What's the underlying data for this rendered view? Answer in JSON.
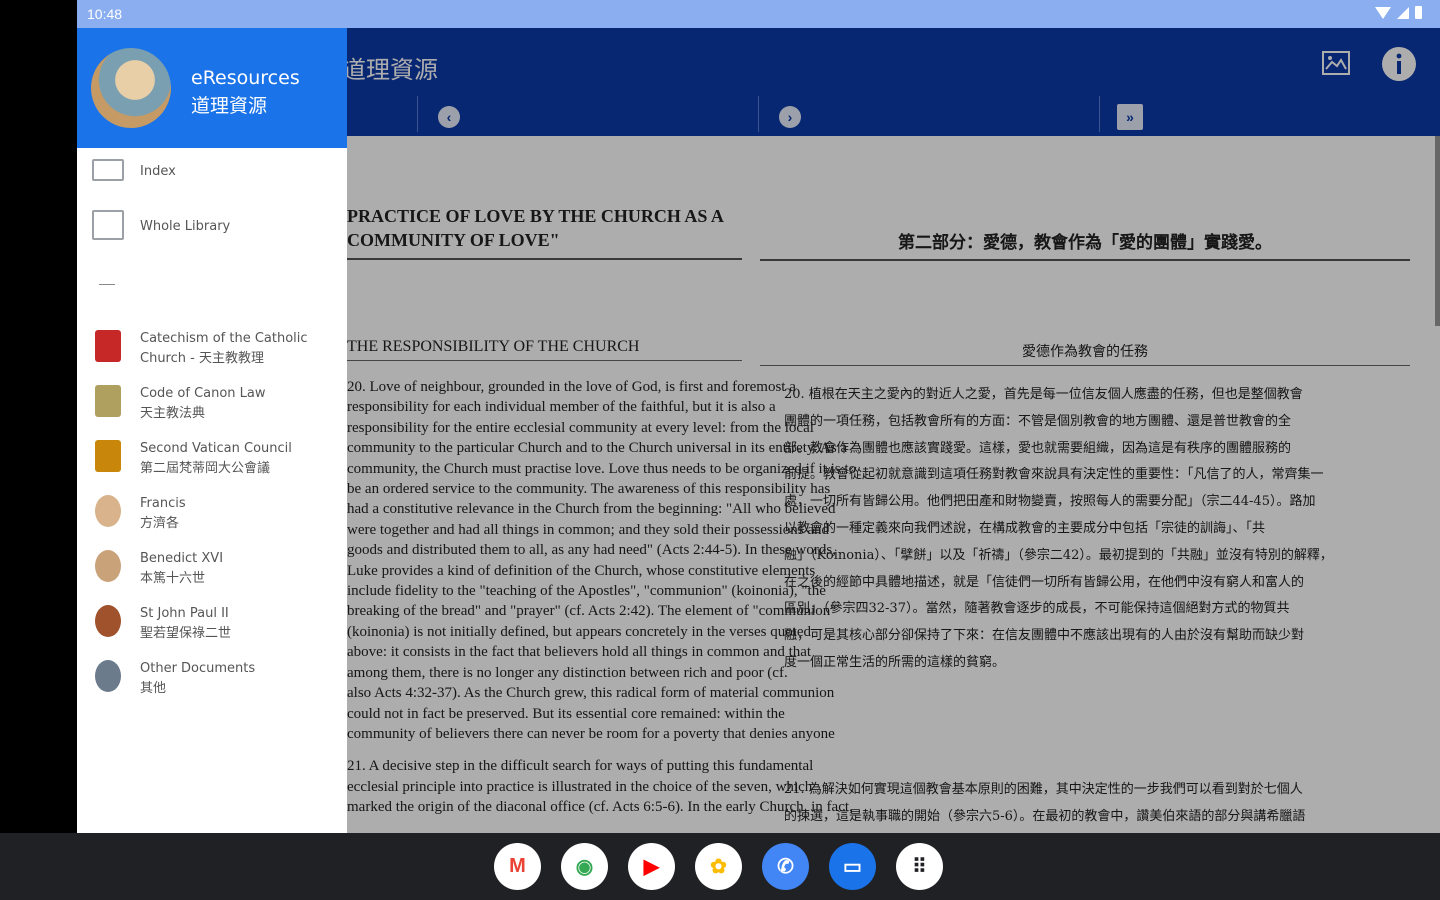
{
  "status": {
    "time": "10:48"
  },
  "app": {
    "title": "道理資源"
  },
  "drawer": {
    "title_line1": "eResources",
    "title_line2": "道理資源",
    "items": [
      {
        "line1": "Index",
        "line2": "",
        "icon": "list-icon"
      },
      {
        "line1": "Whole Library",
        "line2": "",
        "icon": "library-icon"
      },
      {
        "line1": "Catechism of the Catholic",
        "line2": "Church - 天主教教理",
        "icon": "catechism-icon"
      },
      {
        "line1": "Code of Canon Law",
        "line2": "天主教法典",
        "icon": "canon-law-icon"
      },
      {
        "line1": "Second Vatican Council",
        "line2": "第二屆梵蒂岡大公會議",
        "icon": "vatican-council-icon"
      },
      {
        "line1": "Francis",
        "line2": "方濟各",
        "icon": "pope-francis-icon"
      },
      {
        "line1": "Benedict XVI",
        "line2": "本篤十六世",
        "icon": "pope-benedict-icon"
      },
      {
        "line1": "St John Paul II",
        "line2": "聖若望保祿二世",
        "icon": "pope-john-paul-icon"
      },
      {
        "line1": "Other Documents",
        "line2": "其他",
        "icon": "other-documents-icon"
      }
    ]
  },
  "content": {
    "heading_en_1": "PRACTICE OF LOVE BY THE CHURCH AS A",
    "heading_en_2": "COMMUNITY OF LOVE\"",
    "heading_zh": "第二部分：愛德，教會作為「愛的團體」實踐愛。",
    "sub_en": "THE RESPONSIBILITY OF THE CHURCH",
    "sub_zh": "愛德作為教會的任務",
    "para20_en": [
      "20. Love of neighbour, grounded in the love of God, is first and foremost a",
      "responsibility for each individual member of the faithful, but it is also a",
      "responsibility for the entire ecclesial community at every level: from the local",
      "community to the particular Church and to the Church universal in its entirety. As a",
      "community, the Church must practise love. Love thus needs to be organized if it is to",
      "be an ordered service to the community. The awareness of this responsibility has",
      "had a constitutive relevance in the Church from the beginning: \"All who believed",
      "were together and had all things in common; and they sold their possessions and",
      "goods and distributed them to all, as any had need\" (Acts 2:44-5). In these words,",
      "Luke provides a kind of definition of the Church, whose constitutive elements",
      "include fidelity to the \"teaching of the Apostles\", \"communion\" (koinonia), \"the",
      "breaking of the bread\" and \"prayer\" (cf. Acts 2:42). The element of \"communion\"",
      "(koinonia) is not initially defined, but appears concretely in the verses quoted",
      "above: it consists in the fact that believers hold all things in common and that",
      "among them, there is no longer any distinction between rich and poor (cf.",
      "also Acts 4:32-37). As the Church grew, this radical form of material communion",
      "could not in fact be preserved. But its essential core remained: within the",
      "community of believers there can never be room for a poverty that denies anyone"
    ],
    "para21_en": [
      "21. A decisive step in the difficult search for ways of putting this fundamental",
      "ecclesial principle into practice is illustrated in the choice of the seven, which",
      "marked the origin of the diaconal office (cf. Acts 6:5-6). In the early Church, in fact,"
    ],
    "para20_zh": [
      "20. 植根在天主之愛內的對近人之愛，首先是每一位信友個人應盡的任務，但也是整個教會",
      "團體的一項任務，包括教會所有的方面：不管是個別教會的地方團體、還是普世教會的全",
      "部。教會作為團體也應該實踐愛。這樣，愛也就需要組織，因為這是有秩序的團體服務的",
      "前提。教會從起初就意識到這項任務對教會來說具有決定性的重要性：「凡信了的人，常齊集一",
      "處，一切所有皆歸公用。他們把田產和財物變賣，按照每人的需要分配」（宗二44-45）。路加",
      "以教會的一種定義來向我們述說，在構成教會的主要成分中包括「宗徒的訓誨」、「共",
      "融」（Koinonia）、「擘餅」以及「祈禱」（參宗二42）。最初提到的「共融」並沒有特別的解釋，",
      "在之後的經節中具體地描述，就是「信徒們一切所有皆歸公用，在他們中沒有窮人和富人的",
      "區別」（參宗四32-37）。當然，隨著教會逐步的成長，不可能保持這個絕對方式的物質共",
      "融，可是其核心部分卻保持了下來：在信友團體中不應該出現有的人由於沒有幫助而缺少對",
      "度一個正常生活的所需的這樣的貧窮。"
    ],
    "para21_zh": [
      "21. 為解決如何實現這個教會基本原則的困難，其中決定性的一步我們可以看到對於七個人",
      "的揀選，這是執事職的開始（參宗六5-6）。在最初的教會中，讚美伯來語的部分與講希臘語"
    ]
  },
  "dock": {
    "apps": [
      {
        "name": "gmail-app",
        "glyph": "M",
        "bg": "#ffffff",
        "fg": "#ea4335"
      },
      {
        "name": "chrome-app",
        "glyph": "◉",
        "bg": "#ffffff",
        "fg": "#34a853"
      },
      {
        "name": "youtube-app",
        "glyph": "▶",
        "bg": "#ffffff",
        "fg": "#ff0000"
      },
      {
        "name": "photos-app",
        "glyph": "✿",
        "bg": "#ffffff",
        "fg": "#fbbc04"
      },
      {
        "name": "phone-app",
        "glyph": "✆",
        "bg": "#4285f4",
        "fg": "#ffffff"
      },
      {
        "name": "messages-app",
        "glyph": "▭",
        "bg": "#1a73e8",
        "fg": "#ffffff"
      },
      {
        "name": "app-drawer",
        "glyph": "⠿",
        "bg": "#ffffff",
        "fg": "#202124"
      }
    ]
  },
  "colors": {
    "appbar": "#0b3aa8",
    "drawer_header": "#1a73e8",
    "status_bar": "#8aaef0"
  }
}
